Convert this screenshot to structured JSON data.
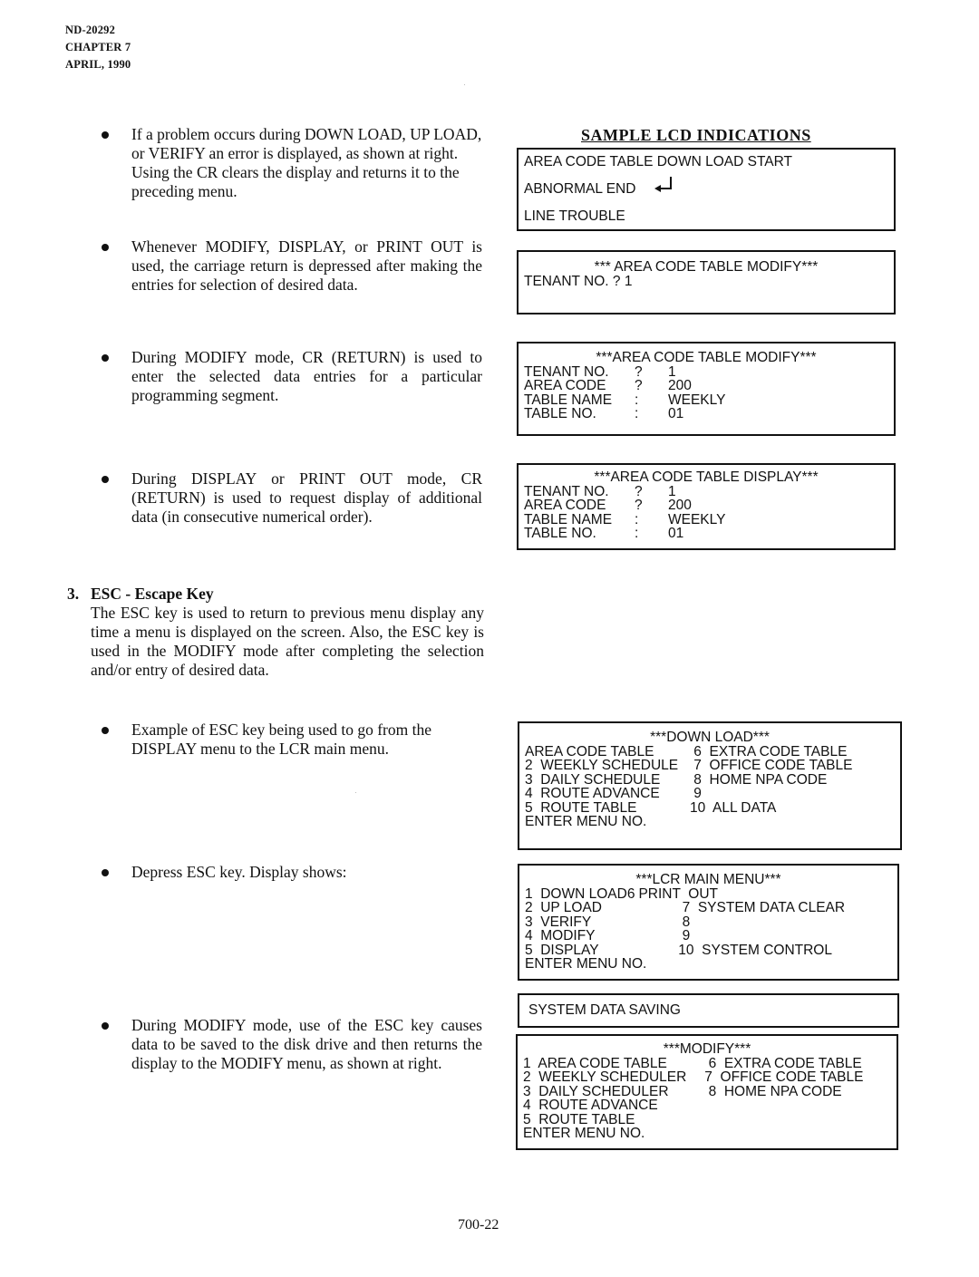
{
  "header": {
    "doc_no": "ND-20292",
    "chapter": "CHAPTER 7",
    "date": "APRIL, 1990"
  },
  "left": {
    "bullets_top": [
      "If a problem occurs during DOWN LOAD, UP LOAD, or VERIFY an error is displayed, as shown at right.  Using the CR clears the display and returns it to the preceding menu.",
      "Whenever MODIFY, DISPLAY, or PRINT OUT is used, the carriage return is depressed after making the entries for selection of desired data.",
      "During MODIFY mode, CR (RETURN) is used to enter the selected data entries for a particular programming segment.",
      "During DISPLAY or PRINT OUT mode, CR (RETURN) is used to request display of additional data (in consecutive numerical order)."
    ],
    "section": {
      "number": "3.",
      "title": "ESC - Escape Key",
      "body": "The ESC key is used to return to previous menu display any time a menu is displayed on the screen.  Also, the ESC key is used in the MODIFY mode after completing the selection and/or entry of desired data."
    },
    "bullets_bottom": [
      "Example of ESC key being used to go from the DISPLAY menu to the LCR main menu.",
      "Depress ESC key.  Display shows:",
      "During MODIFY mode, use of the ESC key causes data to be saved to the disk drive and then returns the display to the MODIFY menu, as shown at right."
    ]
  },
  "right": {
    "heading": "SAMPLE LCD INDICATIONS",
    "error_display": {
      "line1": "AREA CODE TABLE DOWN LOAD START",
      "line2": "ABNORMAL END",
      "line3": "LINE TROUBLE",
      "icon": "return-arrow-icon"
    },
    "modify_prompt": {
      "title": "*** AREA CODE TABLE MODIFY***",
      "line1": "TENANT NO. ? 1"
    },
    "modify_display": {
      "title": "***AREA CODE TABLE MODIFY***",
      "rows": [
        {
          "label": "TENANT NO.",
          "sep": "?",
          "value": "1"
        },
        {
          "label": "AREA CODE",
          "sep": "?",
          "value": "200"
        },
        {
          "label": "TABLE NAME",
          "sep": ":",
          "value": "WEEKLY"
        },
        {
          "label": "TABLE NO.",
          "sep": ":",
          "value": "01"
        }
      ]
    },
    "display_display": {
      "title": "***AREA CODE TABLE DISPLAY***",
      "rows": [
        {
          "label": "TENANT NO.",
          "sep": "?",
          "value": "1"
        },
        {
          "label": "AREA CODE",
          "sep": "?",
          "value": "200"
        },
        {
          "label": "TABLE NAME",
          "sep": ":",
          "value": "WEEKLY"
        },
        {
          "label": "TABLE NO.",
          "sep": ":",
          "value": "01"
        }
      ]
    },
    "download_menu": {
      "title": "***DOWN LOAD***",
      "rows": [
        {
          "left": "AREA CODE TABLE",
          "right": " 6  EXTRA CODE TABLE"
        },
        {
          "left": "2  WEEKLY SCHEDULE",
          "right": " 7  OFFICE CODE TABLE"
        },
        {
          "left": "3  DAILY SCHEDULE",
          "right": " 8  HOME NPA CODE"
        },
        {
          "left": "4  ROUTE ADVANCE",
          "right": " 9"
        },
        {
          "left": "5  ROUTE TABLE",
          "right": "10  ALL DATA"
        }
      ],
      "prompt": "ENTER MENU NO."
    },
    "main_menu": {
      "title": "***LCR MAIN MENU***",
      "rows": [
        {
          "left": "1  DOWN LOAD6",
          "right": "PRINT  OUT"
        },
        {
          "left": "2  UP LOAD",
          "right": "  7  SYSTEM DATA CLEAR"
        },
        {
          "left": "3  VERIFY",
          "right": "  8"
        },
        {
          "left": "4  MODIFY",
          "right": "  9"
        },
        {
          "left": "5  DISPLAY",
          "right": " 10  SYSTEM CONTROL"
        }
      ],
      "prompt": "ENTER MENU NO."
    },
    "saving": {
      "line1": "SYSTEM DATA SAVING"
    },
    "modify_menu": {
      "title": "***MODIFY***",
      "rows": [
        {
          "left": "1  AREA CODE TABLE",
          "right": "  6  EXTRA CODE TABLE"
        },
        {
          "left": "2  WEEKLY SCHEDULER",
          "right": " 7  OFFICE CODE TABLE"
        },
        {
          "left": "3  DAILY SCHEDULER",
          "right": "  8  HOME NPA CODE"
        },
        {
          "left": "4  ROUTE ADVANCE",
          "right": ""
        },
        {
          "left": "5  ROUTE TABLE",
          "right": ""
        }
      ],
      "prompt": "ENTER MENU NO."
    }
  },
  "footer": {
    "page_number": "700-22"
  }
}
